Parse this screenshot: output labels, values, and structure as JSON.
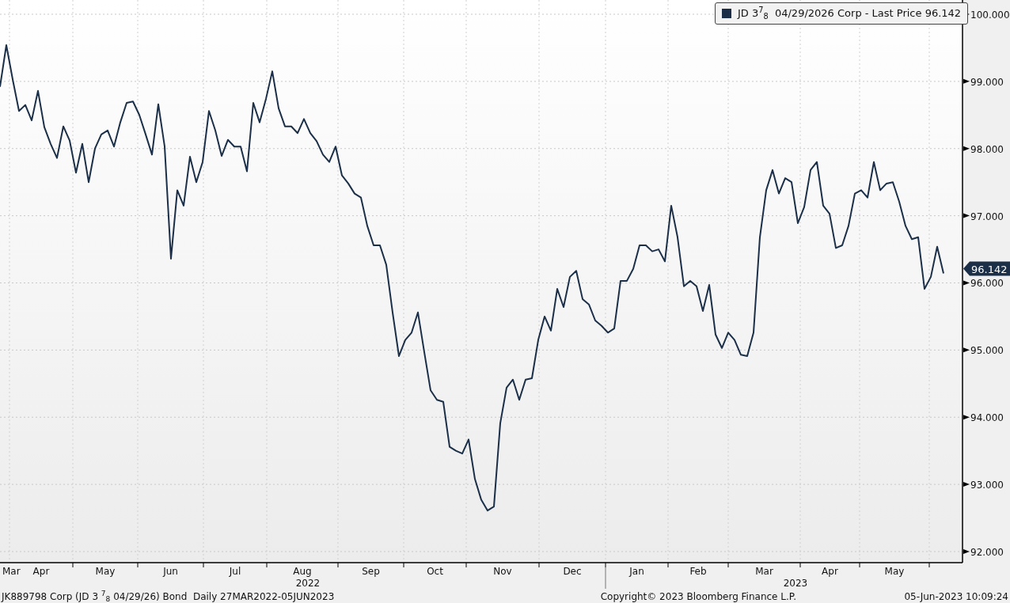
{
  "legend": {
    "label": "JD 3$^{7}$$_{8}$  04/29/2026 Corp - Last Price 96.142"
  },
  "last_price_tag": "96.142",
  "chart_data": {
    "type": "line",
    "grid": true,
    "ylim": [
      91.835,
      100.212
    ],
    "yticks": [
      {
        "value": 92,
        "label": "92.000"
      },
      {
        "value": 93,
        "label": "93.000"
      },
      {
        "value": 94,
        "label": "94.000"
      },
      {
        "value": 95,
        "label": "95.000"
      },
      {
        "value": 96,
        "label": "96.000"
      },
      {
        "value": 97,
        "label": "97.000"
      },
      {
        "value": 98,
        "label": "98.000"
      },
      {
        "value": 99,
        "label": "99.000"
      },
      {
        "value": 100,
        "label": "100.000"
      }
    ],
    "series": [
      {
        "color": "#1b2f48",
        "values": [
          98.92,
          99.54,
          99.03,
          98.56,
          98.65,
          98.42,
          98.86,
          98.32,
          98.07,
          97.86,
          98.33,
          98.12,
          97.64,
          98.07,
          97.5,
          98.0,
          98.21,
          98.27,
          98.03,
          98.39,
          98.68,
          98.7,
          98.5,
          98.21,
          97.91,
          98.66,
          98.03,
          96.36,
          97.38,
          97.15,
          97.88,
          97.5,
          97.8,
          98.56,
          98.27,
          97.89,
          98.13,
          98.03,
          98.03,
          97.66,
          98.68,
          98.39,
          98.74,
          99.15,
          98.6,
          98.33,
          98.33,
          98.23,
          98.44,
          98.23,
          98.11,
          97.91,
          97.8,
          98.03,
          97.6,
          97.48,
          97.33,
          97.27,
          96.85,
          96.56,
          96.56,
          96.27,
          95.56,
          94.91,
          95.15,
          95.26,
          95.56,
          94.97,
          94.4,
          94.26,
          94.23,
          93.56,
          93.5,
          93.46,
          93.67,
          93.08,
          92.77,
          92.61,
          92.67,
          93.91,
          94.44,
          94.56,
          94.26,
          94.56,
          94.58,
          95.15,
          95.5,
          95.29,
          95.91,
          95.64,
          96.09,
          96.18,
          95.76,
          95.68,
          95.44,
          95.36,
          95.26,
          95.32,
          96.03,
          96.03,
          96.21,
          96.56,
          96.56,
          96.47,
          96.5,
          96.32,
          97.15,
          96.68,
          95.95,
          96.03,
          95.95,
          95.58,
          95.97,
          95.23,
          95.03,
          95.26,
          95.15,
          94.93,
          94.91,
          95.26,
          96.68,
          97.38,
          97.68,
          97.33,
          97.56,
          97.5,
          96.89,
          97.13,
          97.68,
          97.8,
          97.15,
          97.03,
          96.52,
          96.56,
          96.85,
          97.33,
          97.38,
          97.27,
          97.8,
          97.38,
          97.48,
          97.5,
          97.21,
          96.85,
          96.65,
          96.68,
          95.91,
          96.09,
          96.54,
          96.14
        ]
      }
    ]
  },
  "x_axis": {
    "months": [
      "Mar",
      "Apr",
      "May",
      "Jun",
      "Jul",
      "Aug",
      "Sep",
      "Oct",
      "Nov",
      "Dec",
      "Jan",
      "Feb",
      "Mar",
      "Apr",
      "May"
    ],
    "years": [
      "2022",
      "2023"
    ]
  },
  "footer": {
    "left": "JK889798 Corp (JD 3 $^{7}$$_{8}$ 04/29/26) Bond  Daily 27MAR2022-05JUN2023",
    "center": "Copyright© 2023 Bloomberg Finance L.P.",
    "right": "05-Jun-2023 10:09:24"
  }
}
